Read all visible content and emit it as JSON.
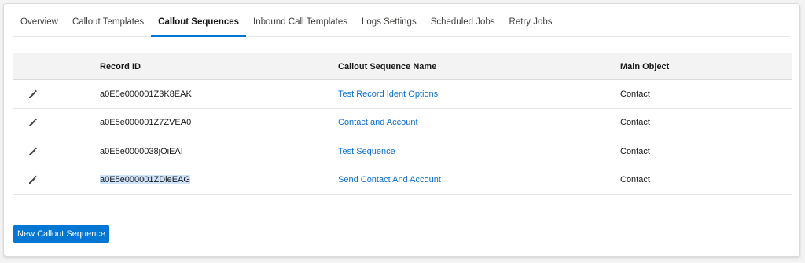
{
  "tabs": [
    {
      "label": "Overview"
    },
    {
      "label": "Callout Templates"
    },
    {
      "label": "Callout Sequences"
    },
    {
      "label": "Inbound Call Templates"
    },
    {
      "label": "Logs Settings"
    },
    {
      "label": "Scheduled Jobs"
    },
    {
      "label": "Retry Jobs"
    }
  ],
  "active_tab": "Callout Sequences",
  "table": {
    "headers": {
      "record_id": "Record ID",
      "name": "Callout Sequence Name",
      "main_object": "Main Object"
    },
    "rows": [
      {
        "record_id": "a0E5e000001Z3K8EAK",
        "name": "Test Record Ident Options",
        "main_object": "Contact"
      },
      {
        "record_id": "a0E5e000001Z7ZVEA0",
        "name": "Contact and Account",
        "main_object": "Contact"
      },
      {
        "record_id": "a0E5e0000038jOiEAI",
        "name": "Test Sequence",
        "main_object": "Contact"
      },
      {
        "record_id": "a0E5e000001ZDieEAG",
        "name": "Send Contact And Account",
        "main_object": "Contact"
      }
    ],
    "edit_icon": "pencil-icon"
  },
  "buttons": {
    "new_sequence": "New Callout Sequence"
  },
  "colors": {
    "accent": "#0176d3",
    "link": "#0b6ecb",
    "header_bg": "#f3f3f3"
  }
}
